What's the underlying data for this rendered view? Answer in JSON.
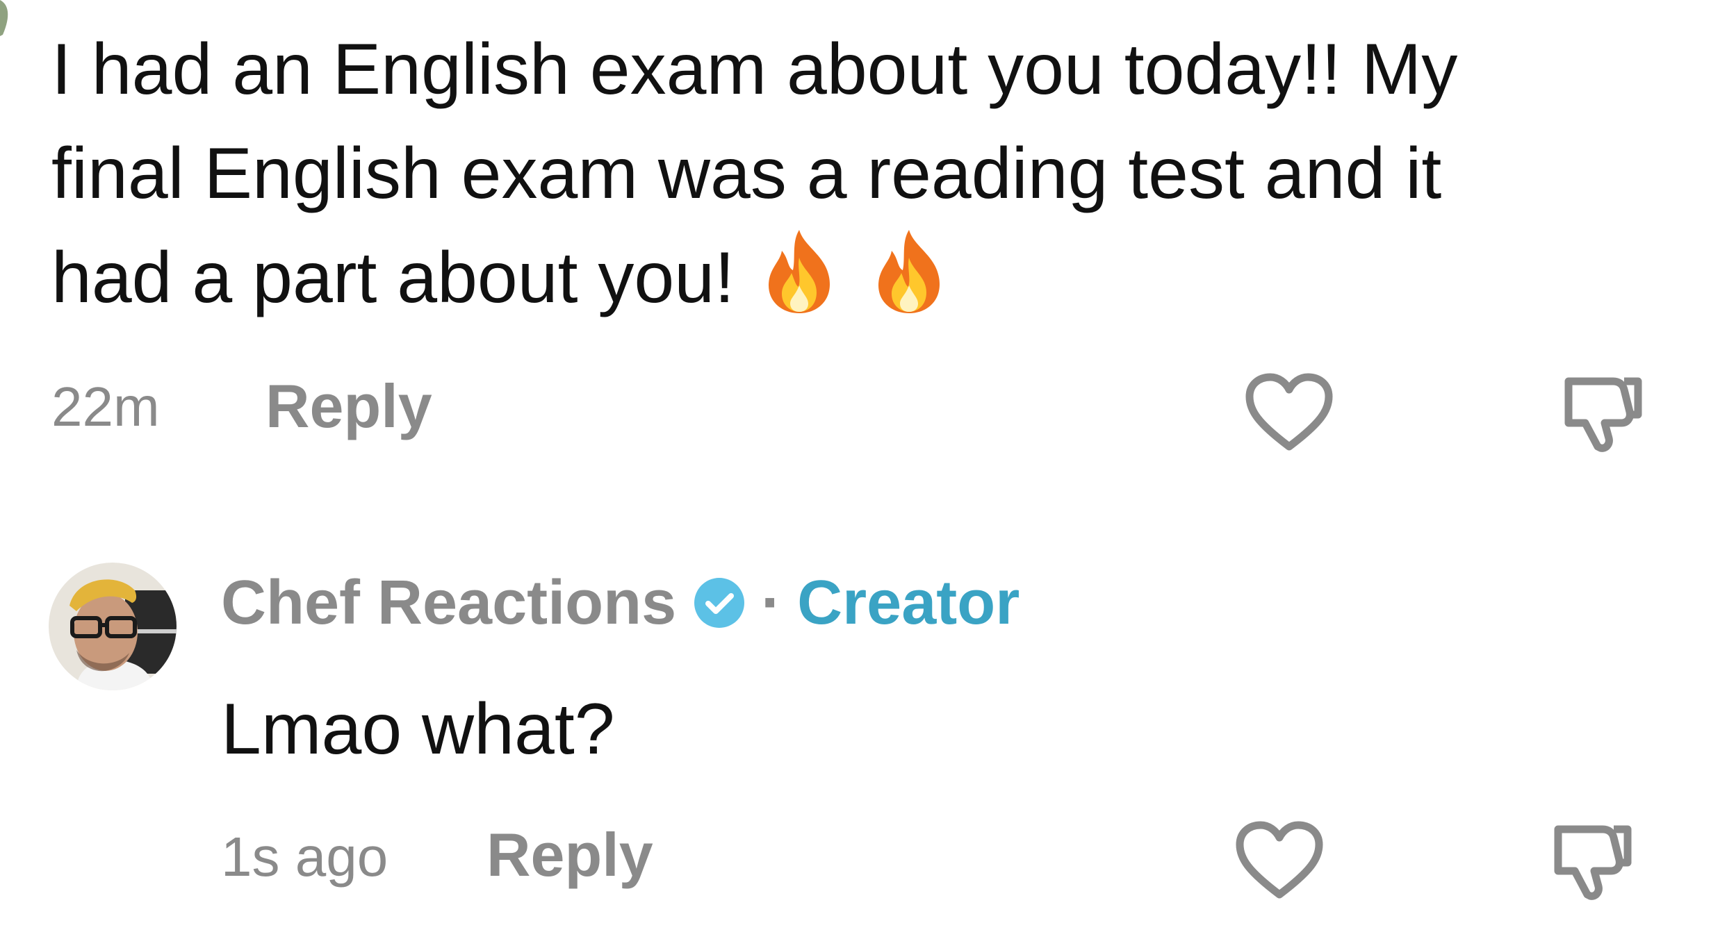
{
  "comment1": {
    "lines": [
      "I had an English exam about you today!! My",
      "final English exam was a reading test and it",
      "had a part about you!"
    ],
    "emojis": [
      "fire-icon",
      "fire-icon"
    ],
    "time": "22m",
    "reply_label": "Reply"
  },
  "comment2": {
    "author": "Chef Reactions",
    "separator": "·",
    "role": "Creator",
    "text": "Lmao what?",
    "time": "1s ago",
    "reply_label": "Reply"
  },
  "colors": {
    "text": "#111111",
    "muted": "#8a8a8a",
    "creator": "#3aa3c4",
    "verified": "#5cc1e6"
  }
}
